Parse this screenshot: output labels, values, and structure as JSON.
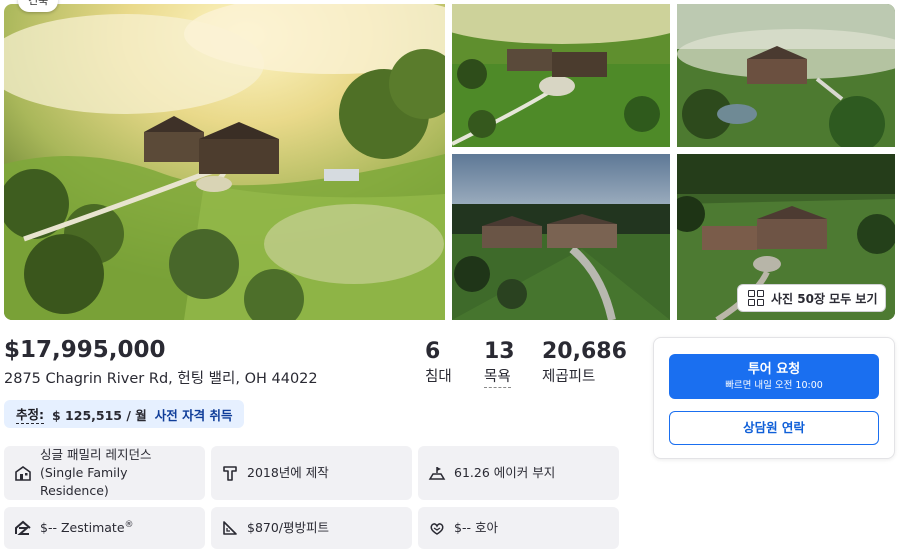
{
  "gallery": {
    "badge": "건축",
    "view_all_label": "사진 50장 모두 보기"
  },
  "listing": {
    "price": "$17,995,000",
    "address": "2875 Chagrin River Rd, 헌팅 밸리, OH 44022",
    "beds": {
      "value": "6",
      "unit": "침대"
    },
    "baths": {
      "value": "13",
      "unit": "목욕"
    },
    "sqft": {
      "value": "20,686",
      "unit": "제곱피트"
    }
  },
  "estimate": {
    "label": "추정:",
    "amount": "$ 125,515 / 월",
    "link": "사전 자격 취득"
  },
  "facts": [
    {
      "icon": "house-icon",
      "text": "싱글 패밀리 레지던스 (Single Family Residence)"
    },
    {
      "icon": "hammer-icon",
      "text": "2018년에 제작"
    },
    {
      "icon": "lot-icon",
      "text": "61.26 에이커 부지"
    },
    {
      "icon": "zestimate-icon",
      "text": "$-- Zestimate",
      "sup": "®"
    },
    {
      "icon": "ruler-icon",
      "text": "$870/평방피트"
    },
    {
      "icon": "hoa-icon",
      "text": "$-- 호아"
    }
  ],
  "actions": {
    "tour_label": "투어 요청",
    "tour_sub": "빠르면 내일 오전 10:00",
    "agent_label": "상담원 연락"
  },
  "colors": {
    "primary_blue": "#1a6ff0",
    "estimate_bg": "#e6f0ff",
    "fact_bg": "#f1f1f4",
    "text": "#2a2a33"
  }
}
